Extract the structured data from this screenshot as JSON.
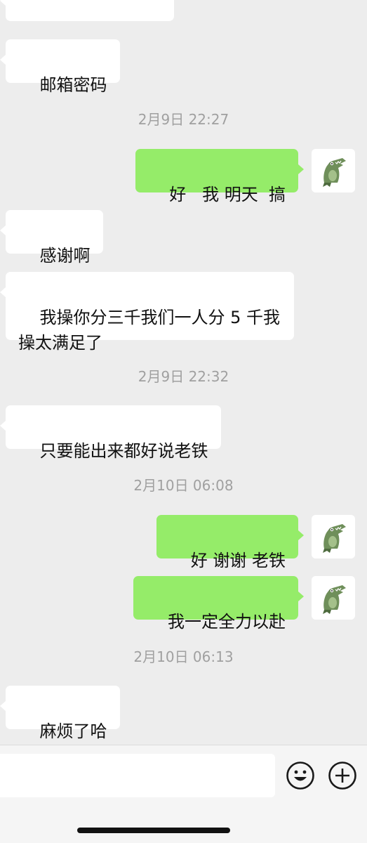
{
  "messages": {
    "m0": "",
    "m1": "邮箱密码",
    "t1": "2月9日 22:27",
    "m2": "好   我 明天  搞",
    "m3": "感谢啊",
    "m4": "我操你分三千我们一人分 5 千我\n操太满足了",
    "t2": "2月9日 22:32",
    "m5": "只要能出来都好说老铁",
    "t3": "2月10日 06:08",
    "m6": "好 谢谢 老铁",
    "m7": "我一定全力以赴",
    "t4": "2月10日 06:13",
    "m8": "麻烦了哈"
  },
  "input": {
    "value": "",
    "placeholder": ""
  },
  "colors": {
    "background": "#ededed",
    "incoming_bubble": "#ffffff",
    "outgoing_bubble": "#95ec69",
    "timestamp_text": "#a0a0a0"
  },
  "icons": {
    "emoji": "smiley-face-icon",
    "more": "plus-circle-icon",
    "avatar": "crocodile-avatar"
  }
}
